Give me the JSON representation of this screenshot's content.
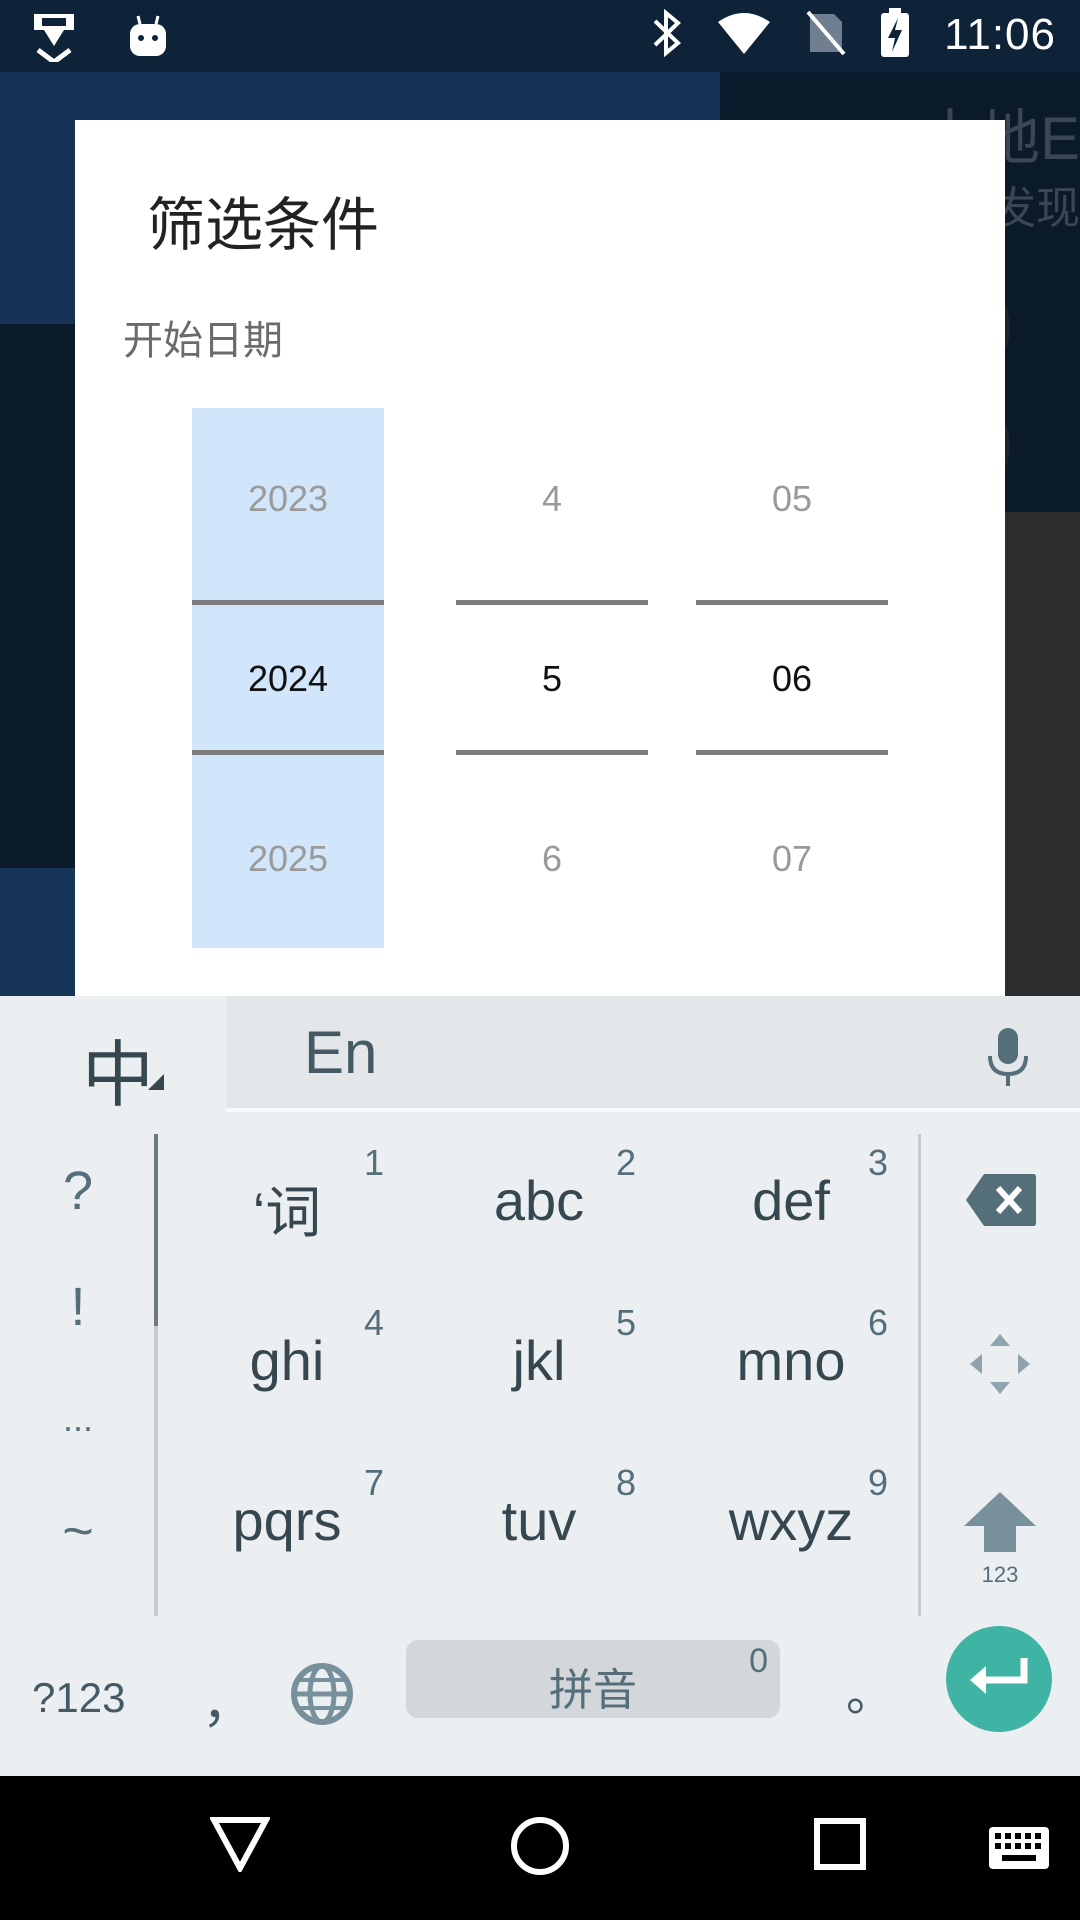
{
  "status_bar": {
    "time": "11:06",
    "left_icons": [
      "download-app-icon",
      "android-notification-icon"
    ],
    "right_icons": [
      "bluetooth-icon",
      "wifi-icon",
      "no-sim-icon",
      "battery-charging-icon"
    ]
  },
  "background_app": {
    "title_partial": "本地E",
    "subtitle_partial": "发现",
    "tail_text": "现。"
  },
  "dialog": {
    "title": "筛选条件",
    "start_date_label": "开始日期",
    "picker_year": {
      "prev": "2023",
      "current": "2024",
      "next": "2025"
    },
    "picker_month": {
      "prev": "4",
      "current": "5",
      "next": "6"
    },
    "picker_day": {
      "prev": "05",
      "current": "06",
      "next": "07"
    }
  },
  "keyboard": {
    "language_key": "中",
    "english_toggle": "En",
    "side_symbols": [
      "?",
      "!",
      "...",
      "~"
    ],
    "keys": [
      {
        "label": "‘词",
        "num": "1"
      },
      {
        "label": "abc",
        "num": "2"
      },
      {
        "label": "def",
        "num": "3"
      },
      {
        "label": "ghi",
        "num": "4"
      },
      {
        "label": "jkl",
        "num": "5"
      },
      {
        "label": "mno",
        "num": "6"
      },
      {
        "label": "pqrs",
        "num": "7"
      },
      {
        "label": "tuv",
        "num": "8"
      },
      {
        "label": "wxyz",
        "num": "9"
      }
    ],
    "shift_sublabel": "123",
    "symbols_key": "?123",
    "comma_key": "，",
    "space_label": "拼音",
    "space_num": "0",
    "period_key": "。",
    "colors": {
      "background": "#eceff1",
      "enter": "#3fb3a4",
      "key_text": "#37474f"
    }
  },
  "nav_bar": {
    "icons": [
      "back-icon",
      "home-icon",
      "recents-icon",
      "keyboard-switch-icon"
    ]
  }
}
